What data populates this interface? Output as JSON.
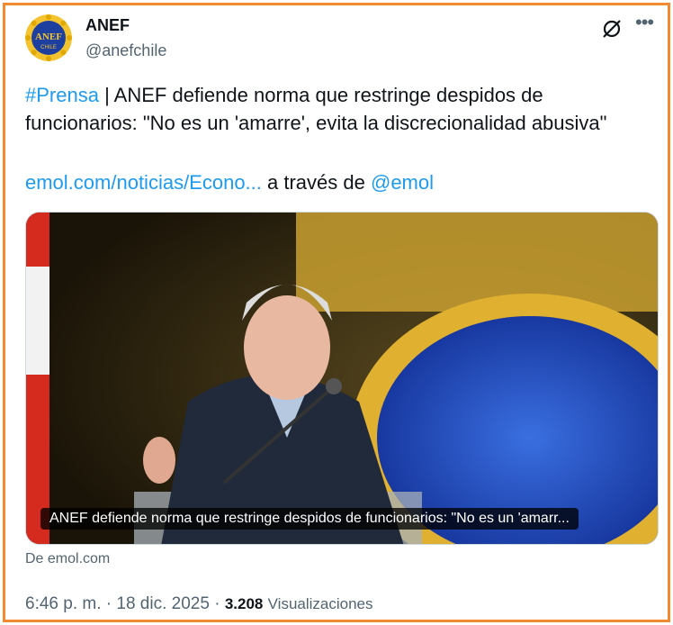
{
  "account": {
    "name": "ANEF",
    "handle": "@anefchile",
    "avatar_icon": "anef-chile-logo"
  },
  "actions": {
    "grok_icon": "grok-slash-icon",
    "more_icon": "more-dots-icon"
  },
  "tweet": {
    "hashtag": "#Prensa",
    "text": " | ANEF defiende norma que restringe despidos de funcionarios: \"No es un 'amarre', evita la discrecionalidad abusiva\"",
    "link": "emol.com/noticias/Econo...",
    "via_text": " a través de ",
    "mention": "@emol"
  },
  "card": {
    "caption": "ANEF defiende norma que restringe despidos de funcionarios: \"No es un 'amarr...",
    "source": "De emol.com"
  },
  "meta": {
    "time": "6:46 p. m.",
    "separator": " · ",
    "date": "18 dic. 2025",
    "views_count": "3.208",
    "views_label": "Visualizaciones"
  },
  "colors": {
    "border": "#f28b30",
    "link": "#1d9bf0",
    "muted": "#536471"
  }
}
